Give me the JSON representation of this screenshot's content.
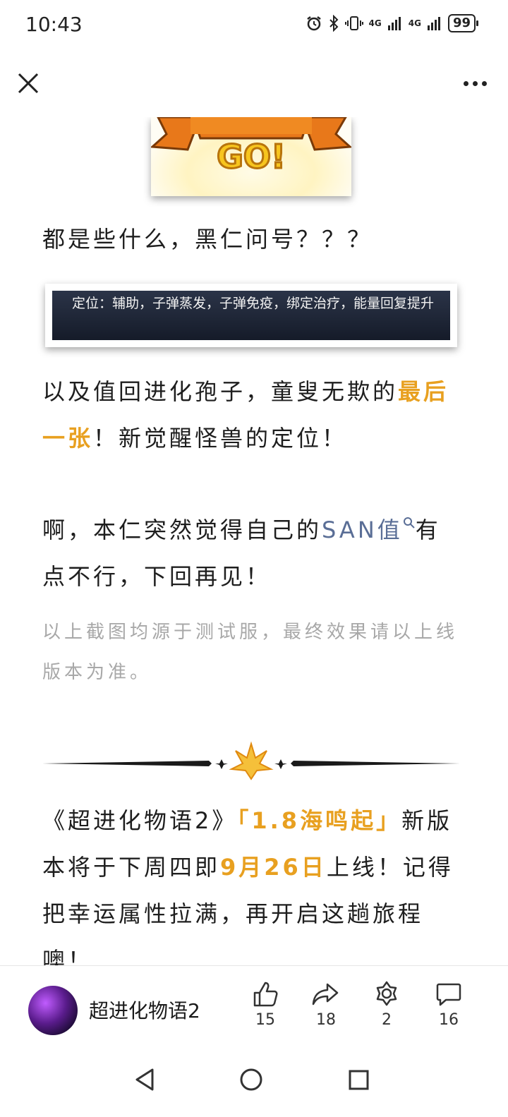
{
  "status_bar": {
    "time": "10:43",
    "network_1": "4G",
    "network_2": "4G",
    "battery": "99"
  },
  "article": {
    "banner_text": "GO!",
    "para1": "都是些什么，黑仁问号？？？",
    "tooltip_text": "定位：辅助，子弹蒸发，子弹免疫，绑定治疗，能量回复提升",
    "para2_a": "以及值回进化孢子，童叟无欺的",
    "para2_hl": "最后一张",
    "para2_b": "！新觉醒怪兽的定位！",
    "para3_a": "啊，本仁突然觉得自己的",
    "para3_link": "SAN值",
    "para3_b": "有点不行，下回再见！",
    "note": "以上截图均源于测试服，最终效果请以上线版本为准。",
    "para4_a": "《超进化物语2》",
    "para4_hl1": "「1.8海鸣起」",
    "para4_b": "新版本将于下周四即",
    "para4_hl2": "9月26日",
    "para4_c": "上线！记得把幸运属性拉满，再开启这趟旅程噢！"
  },
  "bottom_bar": {
    "account_name": "超进化物语2",
    "like_count": "15",
    "share_count": "18",
    "award_count": "2",
    "comment_count": "16"
  },
  "colors": {
    "highlight": "#e8a020",
    "link": "#5a6e96",
    "muted": "#a8a8a8"
  },
  "icons": [
    "close-icon",
    "more-icon",
    "search-icon",
    "like-icon",
    "share-icon",
    "award-icon",
    "comment-icon",
    "back-icon",
    "home-icon",
    "recents-icon"
  ]
}
